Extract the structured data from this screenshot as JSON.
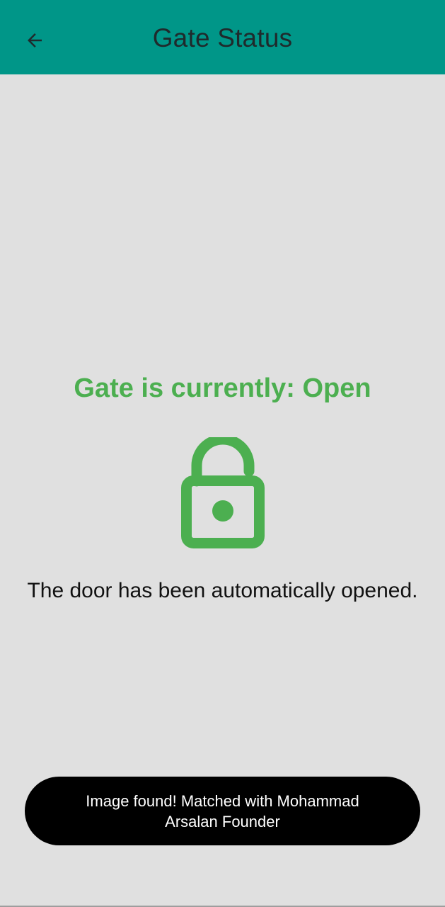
{
  "app_bar": {
    "title": "Gate Status",
    "back_icon": "arrow-left-icon",
    "color": "#009688"
  },
  "status": {
    "title": "Gate is currently: Open",
    "color": "#4caf50",
    "icon": "lock-open-icon",
    "message": "The door has been automatically opened."
  },
  "toast": {
    "text": "Image found! Matched with Mohammad Arsalan Founder"
  }
}
